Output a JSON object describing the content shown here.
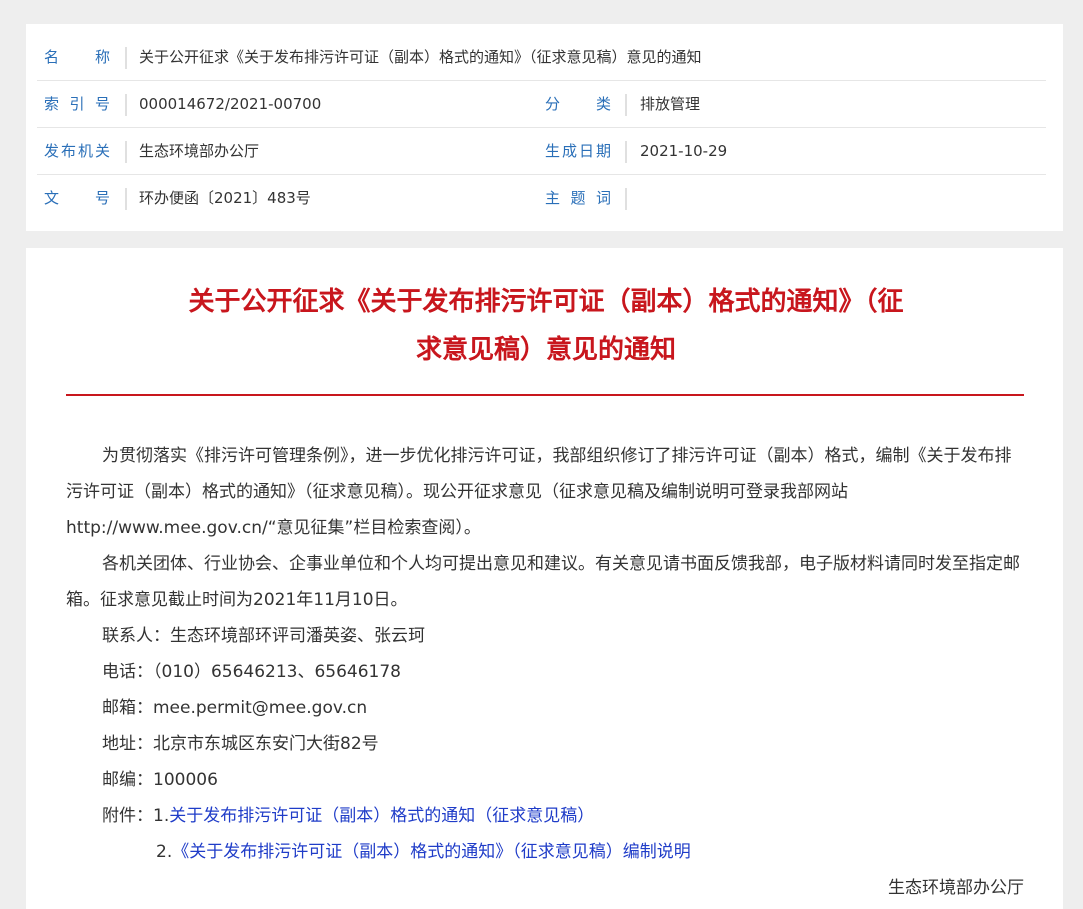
{
  "meta": {
    "name_label": "名　称",
    "name_value": "关于公开征求《关于发布排污许可证（副本）格式的通知》（征求意见稿）意见的通知",
    "index_label": "索 引 号",
    "index_value": "000014672/2021-00700",
    "category_label": "分　类",
    "category_value": "排放管理",
    "issuer_label": "发布机关",
    "issuer_value": "生态环境部办公厅",
    "date_label": "生成日期",
    "date_value": "2021-10-29",
    "docno_label": "文　号",
    "docno_value": "环办便函〔2021〕483号",
    "subject_label": "主 题 词",
    "subject_value": ""
  },
  "article": {
    "title_line1": "关于公开征求《关于发布排污许可证（副本）格式的通知》（征",
    "title_line2": "求意见稿）意见的通知",
    "para1": "为贯彻落实《排污许可管理条例》，进一步优化排污许可证，我部组织修订了排污许可证（副本）格式，编制《关于发布排污许可证（副本）格式的通知》（征求意见稿）。现公开征求意见（征求意见稿及编制说明可登录我部网站http://www.mee.gov.cn/“意见征集”栏目检索查阅）。",
    "para2": "各机关团体、行业协会、企事业单位和个人均可提出意见和建议。有关意见请书面反馈我部，电子版材料请同时发至指定邮箱。征求意见截止时间为2021年11月10日。",
    "contact": "联系人：生态环境部环评司潘英姿、张云珂",
    "phone": "电话：（010）65646213、65646178",
    "email": "邮箱：mee.permit@mee.gov.cn",
    "address": "地址：北京市东城区东安门大街82号",
    "postcode": "邮编：100006",
    "attach_prefix": "附件：1.",
    "attach1": "关于发布排污许可证（副本）格式的通知（征求意见稿）",
    "attach2_prefix": "2.",
    "attach2": "《关于发布排污许可证（副本）格式的通知》（征求意见稿）编制说明",
    "signature": "生态环境部办公厅"
  },
  "colors": {
    "title_red": "#c8161d",
    "label_blue": "#2a6fb8",
    "link_blue": "#1f3cc8"
  }
}
